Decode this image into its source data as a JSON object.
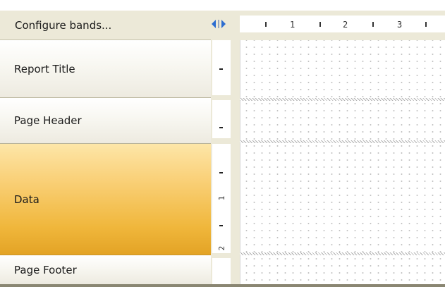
{
  "header": {
    "configure_label": "Configure bands..."
  },
  "bands": [
    {
      "label": "Report Title"
    },
    {
      "label": "Page Header"
    },
    {
      "label": "Data"
    },
    {
      "label": "Page Footer"
    }
  ],
  "ruler": {
    "horizontal_labels": [
      "1",
      "2",
      "3"
    ],
    "vertical_labels": [
      "1",
      "2"
    ]
  },
  "colors": {
    "selected_band": "#f0b73c",
    "panel_bg": "#ece9d8",
    "arrow_accent": "#2c6dd0"
  },
  "icons": {
    "ruler_toggle": "left-right-arrows-icon"
  }
}
